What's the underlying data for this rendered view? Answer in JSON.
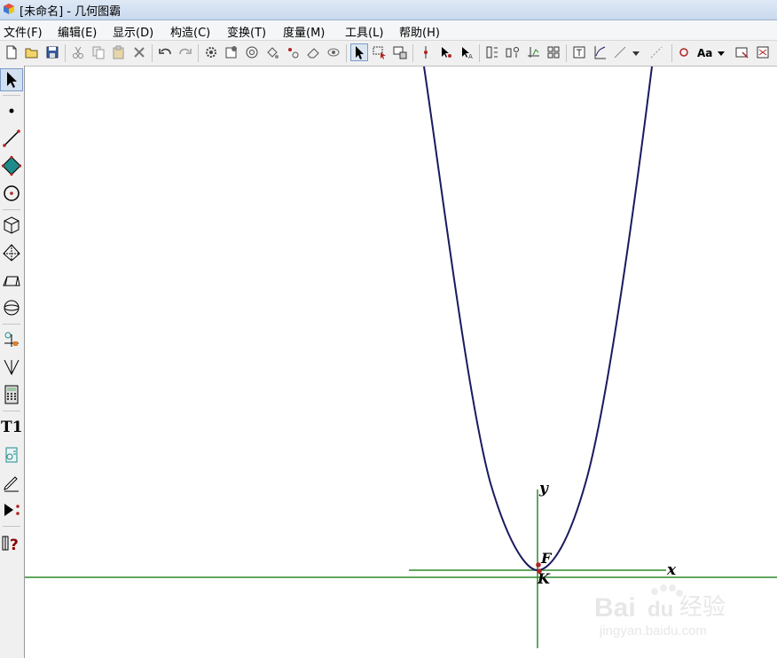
{
  "window": {
    "title": "[未命名] - 几何图霸"
  },
  "menu": {
    "file": "文件(F)",
    "edit": "编辑(E)",
    "display": "显示(D)",
    "construct": "构造(C)",
    "transform": "变换(T)",
    "measure": "度量(M)",
    "tools": "工具(L)",
    "help": "帮助(H)"
  },
  "toolbar": {
    "text_style_label": "Aa"
  },
  "toolbox": {
    "text_tool_label": "T1"
  },
  "canvas": {
    "x_axis_label": "x",
    "y_axis_label": "y",
    "focus_label": "F",
    "vertex_label": "K"
  },
  "watermark": {
    "brand": "Bai",
    "brand_paw": "du",
    "cn": "经验",
    "url": "jingyan.baidu.com"
  },
  "colors": {
    "curve": "#1a1a5e",
    "axis": "#2e8b2e",
    "point": "#b22222"
  }
}
